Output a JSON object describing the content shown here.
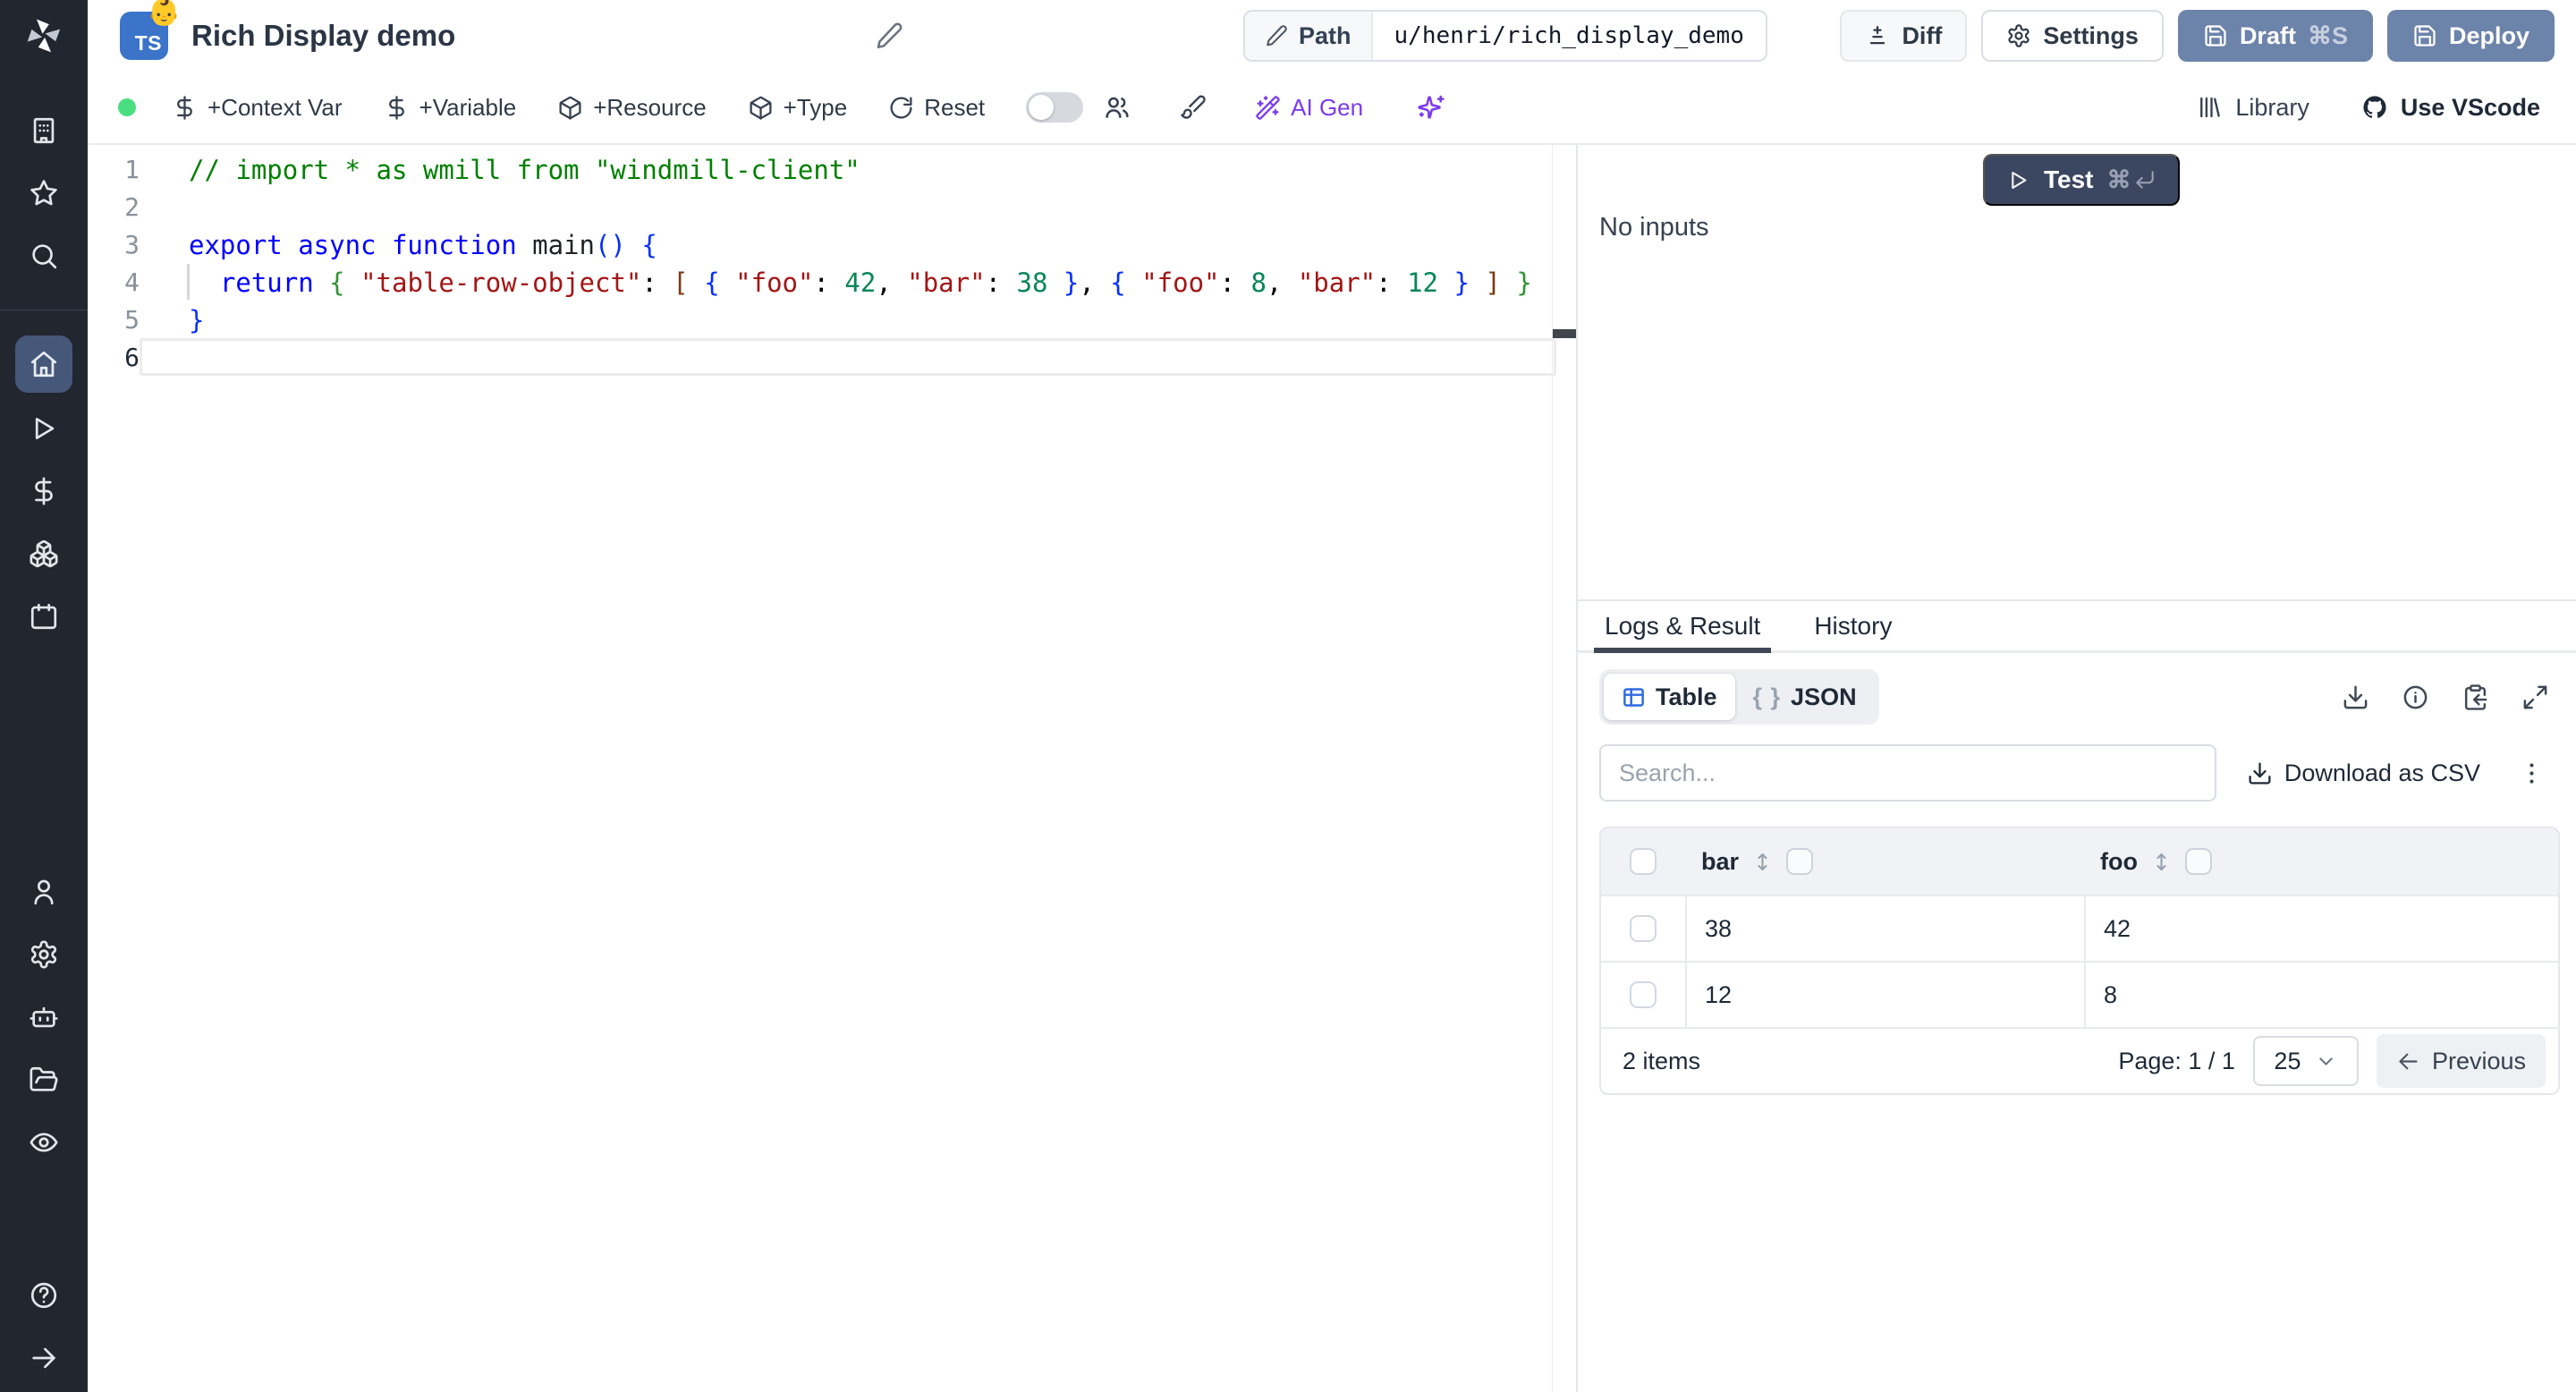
{
  "topbar": {
    "title": "Rich Display demo",
    "language_badge": "TS",
    "badge_emoji": "👶",
    "path_label": "Path",
    "path_value": "u/henri/rich_display_demo",
    "diff": "Diff",
    "settings": "Settings",
    "draft": "Draft",
    "draft_shortcut": "⌘S",
    "deploy": "Deploy"
  },
  "toolbar": {
    "context_var": "+Context Var",
    "variable": "+Variable",
    "resource": "+Resource",
    "type": "+Type",
    "reset": "Reset",
    "ai_gen": "AI Gen",
    "library": "Library",
    "vscode": "Use VScode"
  },
  "sidebar": {
    "icons": [
      "workspace",
      "favorites",
      "search",
      "home",
      "runs",
      "variables",
      "resources",
      "schedules",
      "users",
      "settings",
      "workers",
      "folders",
      "audit-logs",
      "help",
      "expand"
    ]
  },
  "editor": {
    "active_line": 6,
    "lines": [
      {
        "tokens": [
          [
            "// import * as wmill from \"windmill-client\"",
            "comment"
          ]
        ]
      },
      {
        "tokens": []
      },
      {
        "tokens": [
          [
            "export async function ",
            "keyword"
          ],
          [
            "main",
            "func"
          ],
          [
            "()",
            "b1"
          ],
          [
            " ",
            "plain"
          ],
          [
            "{",
            "b1"
          ]
        ]
      },
      {
        "tokens": [
          [
            "  ",
            "plain"
          ],
          [
            "return",
            "keyword"
          ],
          [
            " ",
            "plain"
          ],
          [
            "{",
            "b2"
          ],
          [
            " ",
            "plain"
          ],
          [
            "\"table-row-object\"",
            "string"
          ],
          [
            ": ",
            "plain"
          ],
          [
            "[",
            "b3"
          ],
          [
            " ",
            "plain"
          ],
          [
            "{",
            "b1"
          ],
          [
            " ",
            "plain"
          ],
          [
            "\"foo\"",
            "string"
          ],
          [
            ": ",
            "plain"
          ],
          [
            "42",
            "number"
          ],
          [
            ", ",
            "plain"
          ],
          [
            "\"bar\"",
            "string"
          ],
          [
            ": ",
            "plain"
          ],
          [
            "38",
            "number"
          ],
          [
            " ",
            "plain"
          ],
          [
            "}",
            "b1"
          ],
          [
            ", ",
            "plain"
          ],
          [
            "{",
            "b1"
          ],
          [
            " ",
            "plain"
          ],
          [
            "\"foo\"",
            "string"
          ],
          [
            ": ",
            "plain"
          ],
          [
            "8",
            "number"
          ],
          [
            ", ",
            "plain"
          ],
          [
            "\"bar\"",
            "string"
          ],
          [
            ": ",
            "plain"
          ],
          [
            "12",
            "number"
          ],
          [
            " ",
            "plain"
          ],
          [
            "}",
            "b1"
          ],
          [
            " ",
            "plain"
          ],
          [
            "]",
            "b3"
          ],
          [
            " ",
            "plain"
          ],
          [
            "}",
            "b2"
          ]
        ]
      },
      {
        "tokens": [
          [
            "}",
            "b1"
          ]
        ]
      },
      {
        "tokens": []
      }
    ]
  },
  "run_panel": {
    "test": "Test",
    "test_shortcut": "⌘",
    "no_inputs": "No inputs"
  },
  "result_panel": {
    "tab_logs": "Logs & Result",
    "tab_history": "History",
    "toggle_table": "Table",
    "toggle_json_glyph": "{ }",
    "toggle_json": "JSON",
    "search_placeholder": "Search...",
    "download_csv": "Download as CSV",
    "table": {
      "columns": [
        "bar",
        "foo"
      ],
      "rows": [
        [
          "38",
          "42"
        ],
        [
          "12",
          "8"
        ]
      ],
      "items_label": "2 items",
      "page_label": "Page: 1 / 1",
      "page_size": "25",
      "previous": "Previous"
    }
  },
  "colors": {
    "sidebar_bg": "#21262f",
    "active_nav": "#46587a",
    "slate_button": "#6c83aa",
    "test_button": "#3b4660",
    "ts_blue": "#3b74c9",
    "status_green": "#4ade80",
    "ai_purple": "#7c3aed",
    "table_icon_blue": "#2f6bdf"
  }
}
